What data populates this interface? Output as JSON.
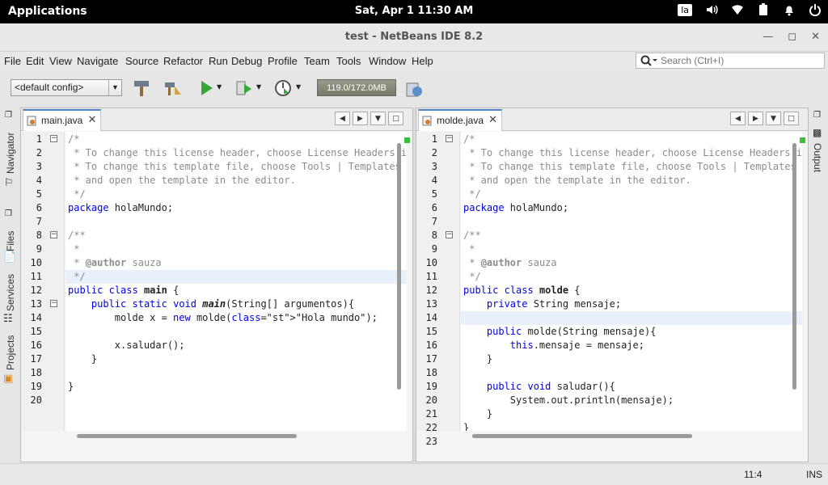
{
  "topbar": {
    "apps": "Applications",
    "clock": "Sat, Apr  1   11:30 AM",
    "lang": "la"
  },
  "window": {
    "title": "test - NetBeans IDE 8.2"
  },
  "menu": [
    "File",
    "Edit",
    "View",
    "Navigate",
    "Source",
    "Refactor",
    "Run",
    "Debug",
    "Profile",
    "Team",
    "Tools",
    "Window",
    "Help"
  ],
  "search": {
    "placeholder": "Search (Ctrl+I)"
  },
  "toolbar": {
    "config": "<default config>",
    "memory": "119.0/172.0MB"
  },
  "left_sidebar": [
    "Navigator",
    "Files",
    "Services",
    "Projects"
  ],
  "right_sidebar": [
    "Output"
  ],
  "editors": [
    {
      "tab": "main.java",
      "lines": [
        "/*",
        " * To change this license header, choose License Headers i",
        " * To change this template file, choose Tools | Templates",
        " * and open the template in the editor.",
        " */",
        "package holaMundo;",
        "",
        "/**",
        " *",
        " * @author sauza",
        " */",
        "public class main {",
        "    public static void main(String[] argumentos){",
        "        molde x = new molde(\"Hola mundo\");",
        "",
        "        x.saludar();",
        "    }",
        "",
        "}",
        ""
      ]
    },
    {
      "tab": "molde.java",
      "lines": [
        "/*",
        " * To change this license header, choose License Headers i",
        " * To change this template file, choose Tools | Templates",
        " * and open the template in the editor.",
        " */",
        "package holaMundo;",
        "",
        "/**",
        " *",
        " * @author sauza",
        " */",
        "public class molde {",
        "    private String mensaje;",
        "",
        "    public molde(String mensaje){",
        "        this.mensaje = mensaje;",
        "    }",
        "",
        "    public void saludar(){",
        "        System.out.println(mensaje);",
        "    }",
        "}",
        ""
      ]
    }
  ],
  "status": {
    "position": "11:4",
    "mode": "INS"
  },
  "colors": {
    "keyword": "#0000e6",
    "string": "#ce7b00",
    "comment": "#8c8c8c",
    "accent": "#4a86c8"
  }
}
